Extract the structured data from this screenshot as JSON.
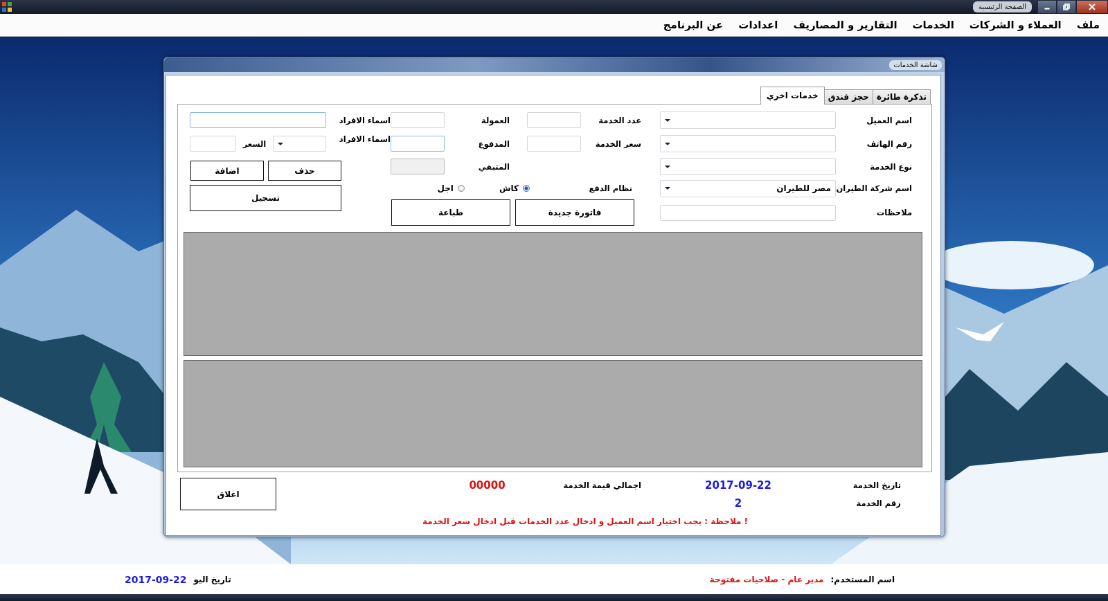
{
  "window": {
    "title": "الصفحة الرئيسية"
  },
  "menu": [
    {
      "label": "ملف"
    },
    {
      "label": "العملاء و الشركات"
    },
    {
      "label": "الخدمات"
    },
    {
      "label": "التقارير و المصاريف"
    },
    {
      "label": "اعدادات"
    },
    {
      "label": "عن البرنامج"
    }
  ],
  "dialog": {
    "title": "شاشة الخدمات",
    "tabs": [
      {
        "label": "تذكرة طائرة",
        "selected": false
      },
      {
        "label": "حجز فندق",
        "selected": false
      },
      {
        "label": "خدمات اخري",
        "selected": true
      }
    ],
    "client_fields": [
      {
        "label": "اسم العميل",
        "kind": "combo"
      },
      {
        "label": "رقم الهاتف",
        "kind": "combo"
      },
      {
        "label": "نوع الخدمة",
        "kind": "combo"
      },
      {
        "label": "اسم شركة الطيران",
        "kind": "combo",
        "value": "مصر للطيران"
      },
      {
        "label": "ملاحظات",
        "kind": "text"
      }
    ],
    "service_fields": [
      {
        "label": "عدد الخدمة"
      },
      {
        "label": "سعر الخدمة"
      }
    ],
    "payment_fields": [
      {
        "label": "العمولة",
        "disabled": false,
        "focused": false
      },
      {
        "label": "المدفوع",
        "disabled": false,
        "focused": true
      },
      {
        "label": "المتبقي",
        "disabled": true,
        "focused": false
      }
    ],
    "payment_system": {
      "label": "نظام الدفع",
      "options": [
        {
          "label": "كاش",
          "selected": true
        },
        {
          "label": "اجل",
          "selected": false
        }
      ]
    },
    "action_buttons": [
      "فاتورة جديدة",
      "طباعة"
    ],
    "members": {
      "names_label": "اسماء الافراد",
      "names_focused": true,
      "names_label_2": "اسماء الافراد",
      "price_label": "السعر",
      "buttons": [
        "حذف",
        "اضافة"
      ],
      "save_button": "تسجيل"
    },
    "summary": {
      "date_label": "تاريخ الخدمة",
      "date": "2017-09-22",
      "total_label": "اجمالي قيمة الخدمة",
      "total": "00000",
      "number_label": "رقم الخدمة",
      "number": "2"
    },
    "close_button": "اغلاق",
    "note": "! ملاحظة : يجب اختيار اسم العميل و ادخال عدد الخدمات قبل ادخال سعر الخدمة"
  },
  "status_bar": {
    "user_label": "اسم المستخدم:",
    "user": "مدير عام - صلاحيات مفتوحة",
    "date_label": "تاريخ اليو",
    "date": "2017-09-22"
  }
}
